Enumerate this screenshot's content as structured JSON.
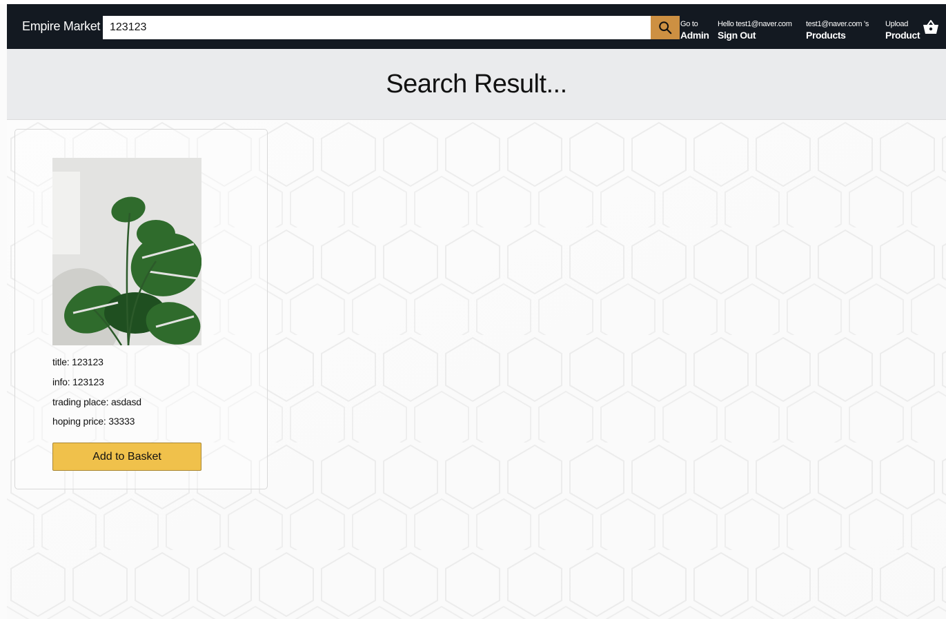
{
  "header": {
    "logo": "Empire Market",
    "search": {
      "value": "123123"
    },
    "nav": [
      {
        "line1": "Go to",
        "line2": "Admin"
      },
      {
        "line1": "Hello test1@naver.com",
        "line2": "Sign Out"
      },
      {
        "line1": "test1@naver.com 's",
        "line2": "Products"
      },
      {
        "line1": "Upload",
        "line2": "Product"
      }
    ]
  },
  "page_title": "Search Result...",
  "products": [
    {
      "title": "title: 123123",
      "info": "info: 123123",
      "trading_place": "trading place: asdasd",
      "hoping_price": "hoping price: 33333",
      "button_label": "Add to Basket"
    }
  ],
  "colors": {
    "header_bg": "#131921",
    "search_button": "#cd9042",
    "add_button": "#f0c14b",
    "title_band": "#eaebed"
  },
  "icons": {
    "search": "search-icon",
    "basket": "basket-icon"
  }
}
